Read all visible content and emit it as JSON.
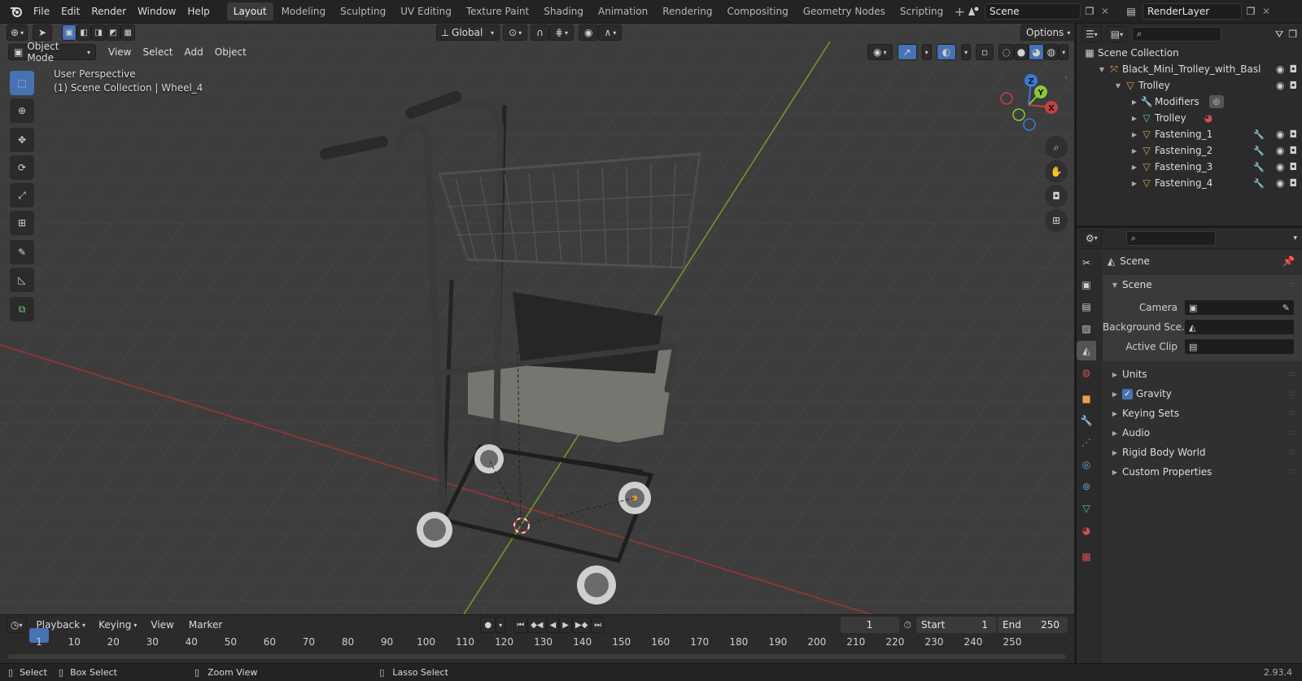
{
  "topbar": {
    "menus": [
      "File",
      "Edit",
      "Render",
      "Window",
      "Help"
    ],
    "workspaces": [
      "Layout",
      "Modeling",
      "Sculpting",
      "UV Editing",
      "Texture Paint",
      "Shading",
      "Animation",
      "Rendering",
      "Compositing",
      "Geometry Nodes",
      "Scripting"
    ],
    "active_workspace": "Layout",
    "scene_name": "Scene",
    "view_layer": "RenderLayer"
  },
  "viewport": {
    "transform_orientation": "Global",
    "options_label": "Options",
    "mode": "Object Mode",
    "menus": [
      "View",
      "Select",
      "Add",
      "Object"
    ],
    "info_line1": "User Perspective",
    "info_line2": "(1) Scene Collection | Wheel_4",
    "gizmo": {
      "x": "X",
      "y": "Y",
      "z": "Z"
    }
  },
  "outliner": {
    "root": "Scene Collection",
    "items": [
      {
        "label": "Black_Mini_Trolley_with_Basl",
        "depth": 1,
        "icon": "empty-icon",
        "color": "#e8a050"
      },
      {
        "label": "Trolley",
        "depth": 2,
        "icon": "mesh-object-icon",
        "color": "#e8a050"
      },
      {
        "label": "Modifiers",
        "depth": 3,
        "icon": "wrench-icon",
        "color": "#7ab0e0"
      },
      {
        "label": "Trolley",
        "depth": 3,
        "icon": "mesh-data-icon",
        "color": "#5ccf7a"
      },
      {
        "label": "Fastening_1",
        "depth": 3,
        "icon": "mesh-object-icon",
        "color": "#e8a050"
      },
      {
        "label": "Fastening_2",
        "depth": 3,
        "icon": "mesh-object-icon",
        "color": "#e8a050"
      },
      {
        "label": "Fastening_3",
        "depth": 3,
        "icon": "mesh-object-icon",
        "color": "#e8a050"
      },
      {
        "label": "Fastening_4",
        "depth": 3,
        "icon": "mesh-object-icon",
        "color": "#e8a050"
      }
    ]
  },
  "properties": {
    "context": "Scene",
    "panel_title": "Scene",
    "fields": [
      {
        "label": "Camera",
        "icon": "camera-object-icon"
      },
      {
        "label": "Background Sce...",
        "icon": "scene-icon"
      },
      {
        "label": "Active Clip",
        "icon": "clip-icon"
      }
    ],
    "sections": [
      "Units",
      "Gravity",
      "Keying Sets",
      "Audio",
      "Rigid Body World",
      "Custom Properties"
    ],
    "gravity_checked": true
  },
  "timeline": {
    "menus": [
      "Playback",
      "Keying",
      "View",
      "Marker"
    ],
    "current_frame": "1",
    "start_label": "Start",
    "start": "1",
    "end_label": "End",
    "end": "250",
    "ticks": [
      "1",
      "10",
      "20",
      "30",
      "40",
      "50",
      "60",
      "70",
      "80",
      "90",
      "100",
      "110",
      "120",
      "130",
      "140",
      "150",
      "160",
      "170",
      "180",
      "190",
      "200",
      "210",
      "220",
      "230",
      "240",
      "250"
    ]
  },
  "statusbar": {
    "select": "Select",
    "box_select": "Box Select",
    "zoom_view": "Zoom View",
    "lasso_select": "Lasso Select",
    "version": "2.93.4"
  },
  "colors": {
    "accent": "#4772b3",
    "x_axis": "#b23a3a",
    "y_axis": "#7ca52a",
    "object_orange": "#e8a050"
  }
}
